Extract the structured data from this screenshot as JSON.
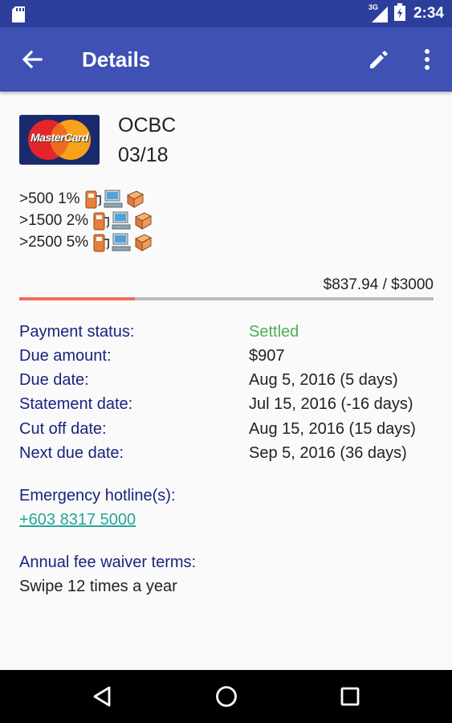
{
  "status_bar": {
    "time": "2:34",
    "network": "3G"
  },
  "app_bar": {
    "title": "Details"
  },
  "card": {
    "brand": "MasterCard",
    "bank": "OCBC",
    "expiry": "03/18"
  },
  "rewards": [
    {
      "label": ">500 1%"
    },
    {
      "label": ">1500 2%"
    },
    {
      "label": ">2500 5%"
    }
  ],
  "spending": {
    "label": "$837.94 / $3000",
    "progress": 0.279
  },
  "details": [
    {
      "label": "Payment status:",
      "value": "Settled"
    },
    {
      "label": "Due amount:",
      "value": "$907"
    },
    {
      "label": "Due date:",
      "value": "Aug 5, 2016 (5 days)"
    },
    {
      "label": "Statement date:",
      "value": "Jul 15, 2016 (-16 days)"
    },
    {
      "label": "Cut off date:",
      "value": "Aug 15, 2016 (15 days)"
    },
    {
      "label": "Next due date:",
      "value": "Sep 5, 2016 (36 days)"
    }
  ],
  "emergency": {
    "label": "Emergency hotline(s):",
    "phone": "+603 8317 5000"
  },
  "waiver": {
    "label": "Annual fee waiver terms:",
    "terms": "Swipe 12 times a year"
  },
  "colors": {
    "primary": "#3f51b5",
    "primary_dark": "#2c3e9b",
    "label_text": "#1a237e",
    "settled": "#4caf50",
    "link": "#26a69a",
    "progress_fill": "#f26c5c"
  }
}
